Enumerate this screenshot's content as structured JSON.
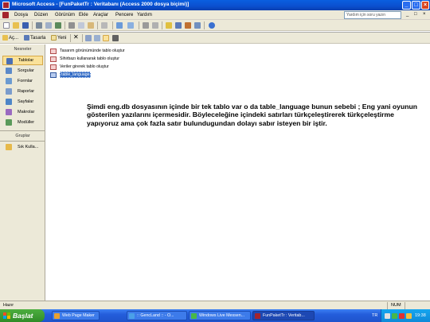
{
  "window": {
    "title": "Microsoft Access - [FunPaketTr : Veritabanı (Access 2000 dosya biçimi)]",
    "minimize": "_",
    "maximize": "□",
    "close": "×"
  },
  "menu": {
    "items": [
      "Dosya",
      "Düzen",
      "Görünüm",
      "Ekle",
      "Araçlar",
      "Pencere",
      "Yardım"
    ],
    "help_placeholder": "Yardım için soru yazın",
    "mdi_buttons": [
      "_",
      "□",
      "×"
    ]
  },
  "db_toolbar": {
    "open": "Aç...",
    "design": "Tasarla",
    "new": "Yeni"
  },
  "sidebar": {
    "objects_header": "Nesneler",
    "groups_header": "Gruplar",
    "items": [
      {
        "label": "Tablolar",
        "icon": "table-icon",
        "color": "#4a6fb5"
      },
      {
        "label": "Sorgular",
        "icon": "query-icon",
        "color": "#5b8ac9"
      },
      {
        "label": "Formlar",
        "icon": "form-icon",
        "color": "#6b9bd1"
      },
      {
        "label": "Raporlar",
        "icon": "report-icon",
        "color": "#7a9ccc"
      },
      {
        "label": "Sayfalar",
        "icon": "page-icon",
        "color": "#4e86c7"
      },
      {
        "label": "Makrolar",
        "icon": "macro-icon",
        "color": "#9a6ac0"
      },
      {
        "label": "Modüller",
        "icon": "module-icon",
        "color": "#5a9a5a"
      }
    ],
    "groups": [
      {
        "label": "Sık Kullanılanlar",
        "display": "Sık Kulla...",
        "icon": "favorites-folder-icon",
        "color": "#e6b94a"
      }
    ]
  },
  "objects": [
    {
      "label": "Tasarım görünümünde tablo oluştur",
      "kind": "wizard"
    },
    {
      "label": "Sihirbazı kullanarak tablo oluştur",
      "kind": "wizard"
    },
    {
      "label": "Veriler girerek tablo oluştur",
      "kind": "wizard"
    },
    {
      "label": "table_language",
      "kind": "table",
      "selected": true
    }
  ],
  "message": "Şimdi eng.db dosyasının içinde bir tek tablo var o da table_language bunun sebebi ; Eng yani oyunun gösterilen yazılarını içermesidir. Böyleceleğine içindeki satırları türkçeleştirerek türkçeleştirme yapıyoruz ama çok fazla satır bulundugundan dolayı sabır isteyen bir iştir.",
  "status": {
    "left": "Hazır",
    "num": "NUM"
  },
  "taskbar": {
    "start": "Başlat",
    "tasks": [
      {
        "label": "Web Page Maker",
        "icon": "webpagemaker-icon",
        "color": "#e8a030"
      },
      {
        "label": ":: GencLand :: - O...",
        "icon": "browser-icon",
        "color": "#4aa0e8"
      },
      {
        "label": "Windows Live Messen...",
        "icon": "messenger-icon",
        "color": "#48b848"
      },
      {
        "label": "FunPaketTr : Veritab...",
        "icon": "access-icon",
        "color": "#a5242d",
        "active": true
      }
    ],
    "lang": "TR",
    "clock": "19:38"
  },
  "colors": {
    "titlebar": "#0b4fcf",
    "selection": "#316ac5",
    "sidebar_selected": "#fae29a"
  }
}
